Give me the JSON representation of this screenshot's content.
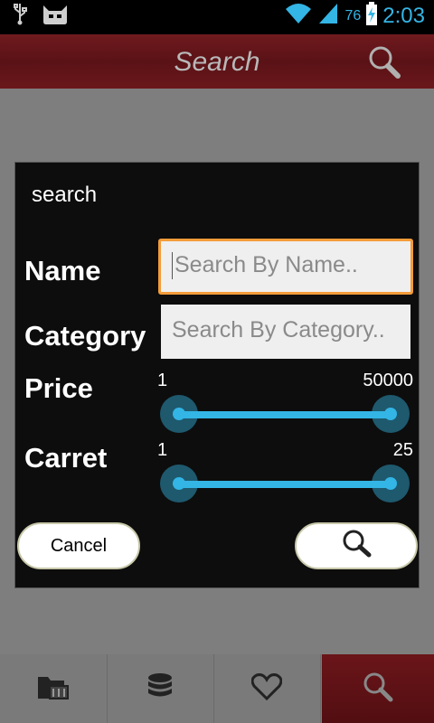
{
  "status_bar": {
    "battery_percent": "76",
    "time": "2:03",
    "icons": [
      "usb-icon",
      "cyanogen-icon",
      "wifi-icon",
      "signal-icon",
      "battery-charging-icon"
    ]
  },
  "action_bar": {
    "title": "Search",
    "search_icon": "search-icon"
  },
  "dialog": {
    "title": "search",
    "name": {
      "label": "Name",
      "placeholder": "Search By Name.."
    },
    "category": {
      "label": "Category",
      "placeholder": "Search By Category.."
    },
    "price": {
      "label": "Price",
      "min_label": "1",
      "max_label": "50000",
      "min": 1,
      "max": 50000,
      "low": 1,
      "high": 50000
    },
    "carret": {
      "label": "Carret",
      "min_label": "1",
      "max_label": "25",
      "min": 1,
      "max": 25,
      "low": 1,
      "high": 25
    },
    "cancel_label": "Cancel",
    "search_button_icon": "search-icon"
  },
  "bottom_nav": {
    "items": [
      {
        "icon": "folder-icon",
        "active": false
      },
      {
        "icon": "stack-icon",
        "active": false
      },
      {
        "icon": "heart-icon",
        "active": false
      },
      {
        "icon": "search-icon",
        "active": true
      }
    ]
  },
  "colors": {
    "accent": "#33b5e5",
    "focus_border": "#f39c3a",
    "action_bar": "#5a1216"
  }
}
